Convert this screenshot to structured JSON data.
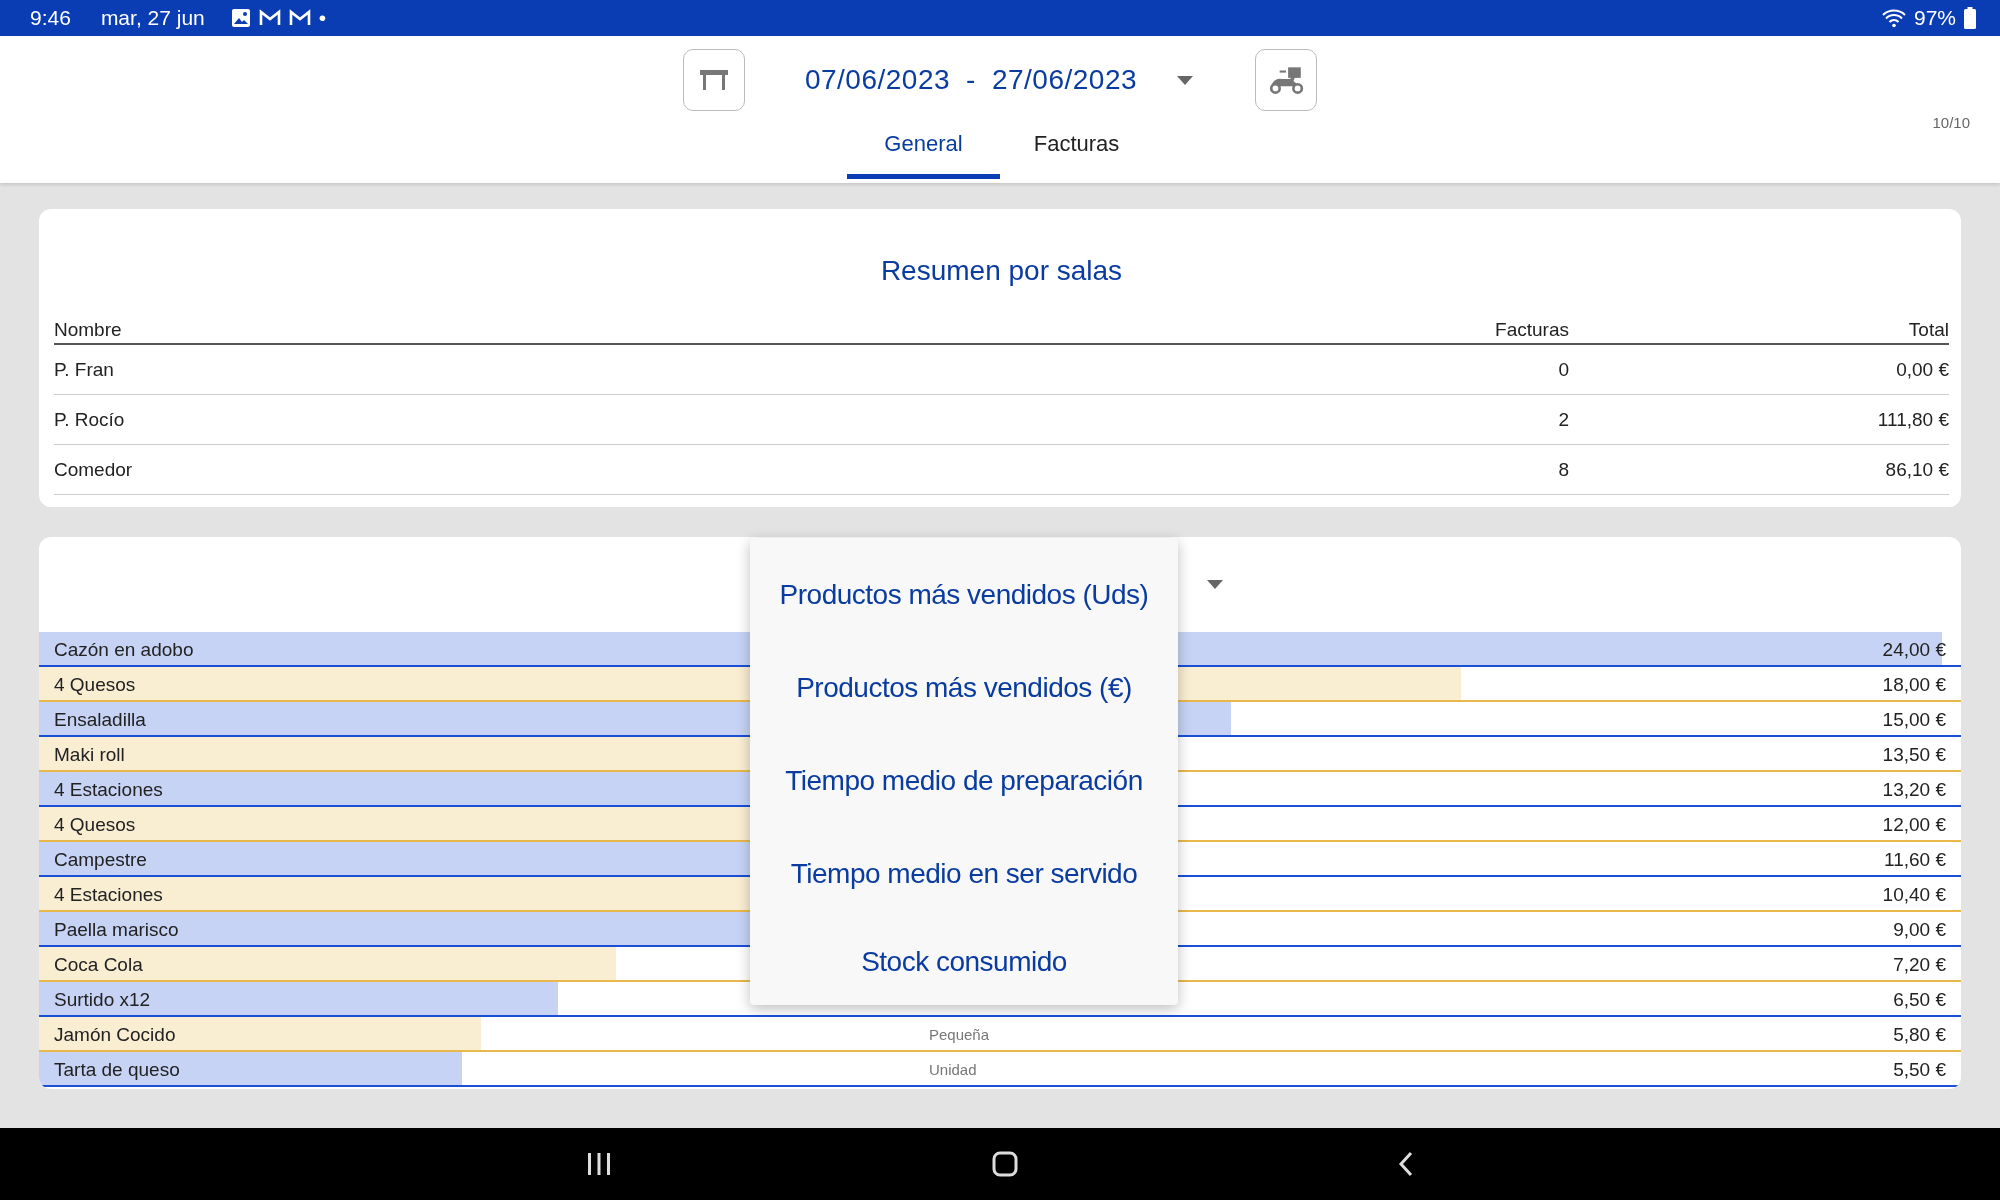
{
  "status_bar": {
    "time": "9:46",
    "date": "mar, 27 jun",
    "dot": "•",
    "battery": "97%"
  },
  "header": {
    "date_range": {
      "start": "07/06/2023",
      "separator": "-",
      "end": "27/06/2023"
    },
    "page_counter": "10/10",
    "tabs": [
      {
        "label": "General",
        "selected": true
      },
      {
        "label": "Facturas",
        "selected": false
      }
    ]
  },
  "summary": {
    "title": "Resumen por salas",
    "columns": [
      "Nombre",
      "Facturas",
      "Total"
    ],
    "rows": [
      [
        "P. Fran",
        "0",
        "0,00 €"
      ],
      [
        "P. Rocío",
        "2",
        "111,80 €"
      ],
      [
        "Comedor",
        "8",
        "86,10 €"
      ]
    ]
  },
  "products": {
    "rows": [
      {
        "name": "Cazón en adobo",
        "value": "24,00 €",
        "level": 0.99,
        "color": "#1a4fd6"
      },
      {
        "name": "4 Quesos",
        "value": "18,00 €",
        "level": 0.74,
        "color": "#e8b84a"
      },
      {
        "name": "Ensaladilla",
        "value": "15,00 €",
        "level": 0.62,
        "color": "#1a4fd6"
      },
      {
        "name": "Maki roll",
        "value": "13,50 €",
        "level": 0.56,
        "color": "#e8b84a"
      },
      {
        "name": "4 Estaciones",
        "value": "13,20 €",
        "level": 0.55,
        "color": "#1a4fd6"
      },
      {
        "name": "4 Quesos",
        "value": "12,00 €",
        "level": 0.5,
        "color": "#e8b84a"
      },
      {
        "name": "Campestre",
        "value": "11,60 €",
        "level": 0.48,
        "color": "#1a4fd6"
      },
      {
        "name": "4 Estaciones",
        "value": "10,40 €",
        "level": 0.43,
        "color": "#e8b84a"
      },
      {
        "name": "Paella marisco",
        "value": "9,00 €",
        "level": 0.37,
        "color": "#1a4fd6"
      },
      {
        "name": "Coca Cola",
        "value": "7,20 €",
        "level": 0.3,
        "color": "#e8b84a"
      },
      {
        "name": "Surtido  x12",
        "value": "6,50 €",
        "level": 0.27,
        "color": "#1a4fd6"
      },
      {
        "name": "Jamón Cocido",
        "subtitle": "Pequeña",
        "value": "5,80 €",
        "level": 0.23,
        "color": "#e8b84a"
      },
      {
        "name": "Tarta de queso",
        "subtitle": "Unidad",
        "value": "5,50 €",
        "level": 0.22,
        "color": "#1a4fd6"
      }
    ]
  },
  "dropdown_menu": {
    "expanded": true,
    "options": [
      "Productos más vendidos (Uds)",
      "Productos más vendidos (€)",
      "Tiempo medio de preparación",
      "Tiempo medio en ser servido",
      "Stock consumido"
    ]
  }
}
